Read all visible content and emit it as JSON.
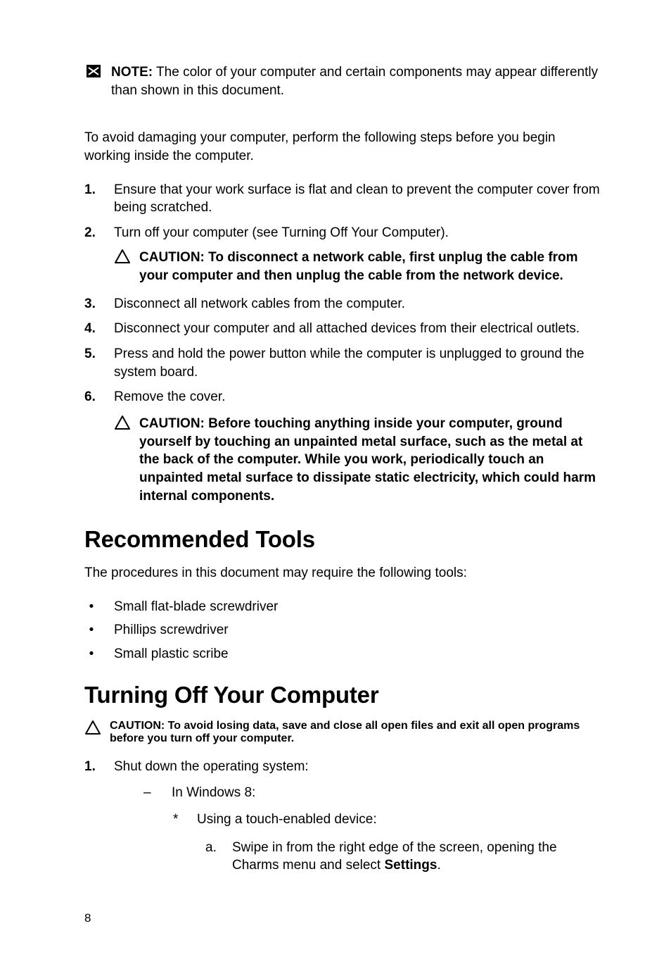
{
  "note": {
    "label": "NOTE:",
    "text": " The color of your computer and certain components may appear differently than shown in this document."
  },
  "intro": "To avoid damaging your computer, perform the following steps before you begin working inside the computer.",
  "steps": {
    "s1": "Ensure that your work surface is flat and clean to prevent the computer cover from being scratched.",
    "s2": "Turn off your computer (see Turning Off Your Computer).",
    "caution_net": {
      "label": "CAUTION: ",
      "text": "To disconnect a network cable, first unplug the cable from your computer and then unplug the cable from the network device."
    },
    "s3": "Disconnect all network cables from the computer.",
    "s4": "Disconnect your computer and all attached devices from their electrical outlets.",
    "s5": "Press and hold the power button while the computer is unplugged to ground the system board.",
    "s6": "Remove the cover.",
    "caution_ground": {
      "label": "CAUTION: ",
      "text": "Before touching anything inside your computer, ground yourself by touching an unpainted metal surface, such as the metal at the back of the computer. While you work, periodically touch an unpainted metal surface to dissipate static electricity, which could harm internal components."
    }
  },
  "tools": {
    "heading": "Recommended Tools",
    "intro": "The procedures in this document may require the following tools:",
    "t1": "Small flat-blade screwdriver",
    "t2": "Phillips screwdriver",
    "t3": "Small plastic scribe"
  },
  "turnoff": {
    "heading": "Turning Off Your Computer",
    "caution": {
      "label": "CAUTION: ",
      "text": "To avoid losing data, save and close all open files and exit all open programs before you turn off your computer."
    },
    "s1": "Shut down the operating system:",
    "sub_dash": "In Windows 8:",
    "sub_star": "Using a touch-enabled device:",
    "sub_a_pre": "Swipe in from the right edge of the screen, opening the Charms menu and select ",
    "sub_a_bold": "Settings",
    "sub_a_post": "."
  },
  "numbers": {
    "n1": "1.",
    "n2": "2.",
    "n3": "3.",
    "n4": "4.",
    "n5": "5.",
    "n6": "6."
  },
  "page_number": "8"
}
